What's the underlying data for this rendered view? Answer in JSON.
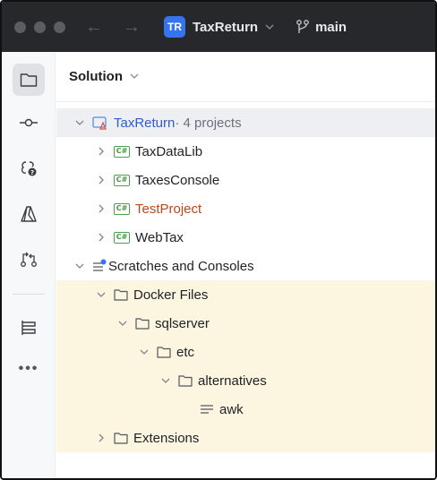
{
  "titlebar": {
    "project_badge": "TR",
    "project_name": "TaxReturn",
    "branch_name": "main"
  },
  "toolstrip": {
    "items": [
      "project-icon",
      "commit-icon",
      "services-icon",
      "azure-icon",
      "pull-requests-icon",
      "structure-icon",
      "more-icon"
    ]
  },
  "panel": {
    "title": "Solution"
  },
  "tree": {
    "solution": {
      "name": "TaxReturn",
      "suffix": " · 4 projects"
    },
    "projects": [
      {
        "name": "TaxDataLib",
        "badge": "C#"
      },
      {
        "name": "TaxesConsole",
        "badge": "C#"
      },
      {
        "name": "TestProject",
        "badge": "C#"
      },
      {
        "name": "WebTax",
        "badge": "C#"
      }
    ],
    "scratches": "Scratches and Consoles",
    "docker_files": "Docker Files",
    "sqlserver": "sqlserver",
    "etc": "etc",
    "alternatives": "alternatives",
    "awk": "awk",
    "extensions": "Extensions"
  },
  "colors": {
    "titlebar_bg": "#27282c",
    "accent": "#3574f0",
    "link": "#2d5bd1",
    "test_project": "#b5491d",
    "highlight_rows": "#fcf5e0"
  }
}
